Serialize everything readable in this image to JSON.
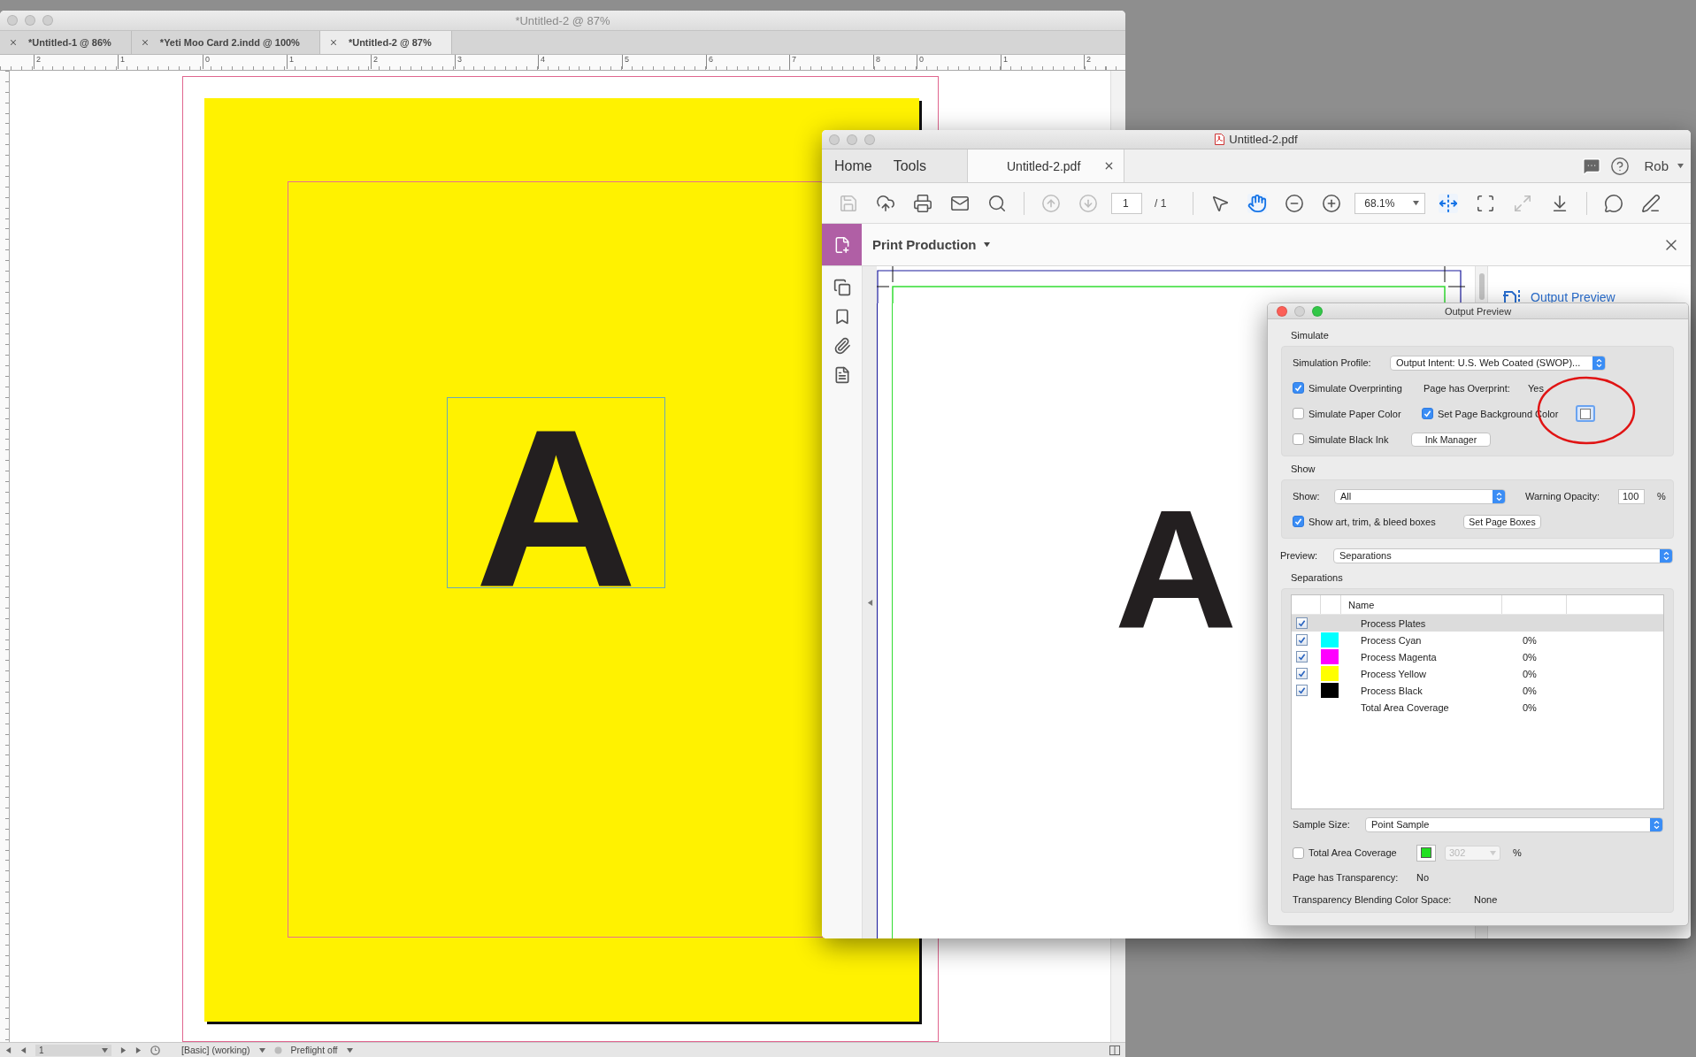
{
  "indesign": {
    "title": "*Untitled-2 @ 87%",
    "tabs": [
      {
        "label": "*Untitled-1 @ 86%",
        "selected": false
      },
      {
        "label": "*Yeti Moo Card 2.indd @ 100%",
        "selected": false
      },
      {
        "label": "*Untitled-2 @ 87%",
        "selected": true
      }
    ],
    "ruler_labels": [
      "2",
      "1",
      "0",
      "1",
      "2",
      "3",
      "4",
      "5",
      "6",
      "7",
      "8",
      "0",
      "1",
      "2"
    ],
    "frame_letter": "A",
    "status_bar": {
      "page": "1",
      "profile": "[Basic] (working)",
      "preflight": "Preflight off"
    }
  },
  "acrobat": {
    "title": "Untitled-2.pdf",
    "nav": [
      "Home",
      "Tools"
    ],
    "document_tab": "Untitled-2.pdf",
    "user": "Rob",
    "toolbar": [
      {
        "kind": "save",
        "disabled": true,
        "selected": false
      },
      {
        "kind": "upload",
        "disabled": false,
        "selected": false
      },
      {
        "kind": "print",
        "disabled": false,
        "selected": false
      },
      {
        "kind": "mail",
        "disabled": false,
        "selected": false
      },
      {
        "kind": "search",
        "disabled": false,
        "selected": false
      },
      {
        "kind": "separator"
      },
      {
        "kind": "prev-page",
        "disabled": true,
        "selected": false
      },
      {
        "kind": "next-page",
        "disabled": true,
        "selected": false
      },
      {
        "kind": "page-field",
        "value": "1",
        "total": "/ 1"
      },
      {
        "kind": "separator"
      },
      {
        "kind": "select",
        "disabled": false,
        "selected": false
      },
      {
        "kind": "hand",
        "disabled": false,
        "selected": true
      },
      {
        "kind": "zoom-out",
        "disabled": false,
        "selected": false
      },
      {
        "kind": "zoom-in",
        "disabled": false,
        "selected": false
      },
      {
        "kind": "zoom-field",
        "value": "68.1%"
      },
      {
        "kind": "fit-width",
        "disabled": false,
        "selected": true
      },
      {
        "kind": "fit-page",
        "disabled": false,
        "selected": false
      },
      {
        "kind": "full-screen",
        "disabled": true,
        "selected": false
      },
      {
        "kind": "scroll-mode",
        "disabled": false,
        "selected": false
      },
      {
        "kind": "separator"
      },
      {
        "kind": "comment",
        "disabled": false,
        "selected": false
      },
      {
        "kind": "sign",
        "disabled": false,
        "selected": false
      }
    ],
    "tool_panel": "Print Production",
    "page_letter": "A",
    "right_panel_link": "Output Preview"
  },
  "output_preview": {
    "title": "Output Preview",
    "simulate": {
      "label": "Simulate",
      "profile_label": "Simulation Profile:",
      "profile": "Output Intent: U.S. Web Coated (SWOP)...",
      "simulate_overprinting": {
        "label": "Simulate Overprinting",
        "checked": true
      },
      "overprint_label": "Page has Overprint:",
      "overprint_value": "Yes",
      "simulate_paper_color": {
        "label": "Simulate Paper Color",
        "checked": false
      },
      "set_page_background_color": {
        "label": "Set Page Background Color",
        "checked": true
      },
      "simulate_black_ink": {
        "label": "Simulate Black Ink",
        "checked": false
      },
      "ink_manager_button": "Ink Manager"
    },
    "show": {
      "label": "Show",
      "show_label": "Show:",
      "show_value": "All",
      "opacity_label": "Warning Opacity:",
      "opacity_value": "100",
      "opacity_unit": "%",
      "show_boxes": {
        "label": "Show art, trim, & bleed boxes",
        "checked": true
      },
      "page_boxes_button": "Set Page Boxes"
    },
    "preview_label": "Preview:",
    "preview_value": "Separations",
    "separations": {
      "label": "Separations",
      "columns": [
        "Name"
      ],
      "rows": [
        {
          "kind": "plates",
          "name": "Process Plates",
          "checked": true,
          "selected": true
        },
        {
          "kind": "ink",
          "name": "Process Cyan",
          "checked": true,
          "selected": false,
          "color": "#00ffff",
          "coverage": "0%"
        },
        {
          "kind": "ink",
          "name": "Process Magenta",
          "checked": true,
          "selected": false,
          "color": "#ff00ff",
          "coverage": "0%"
        },
        {
          "kind": "ink",
          "name": "Process Yellow",
          "checked": true,
          "selected": false,
          "color": "#ffff00",
          "coverage": "0%"
        },
        {
          "kind": "ink",
          "name": "Process Black",
          "checked": true,
          "selected": false,
          "color": "#000000",
          "coverage": "0%"
        },
        {
          "kind": "total",
          "name": "Total Area Coverage",
          "selected": false,
          "coverage": "0%"
        }
      ]
    },
    "sample_size_label": "Sample Size:",
    "sample_size": "Point Sample",
    "total_area_coverage": {
      "label": "Total Area Coverage",
      "checked": false,
      "value": "302",
      "value_disabled": true,
      "unit": "%"
    },
    "transparency_label": "Page has Transparency:",
    "transparency_value": "No",
    "blending_label": "Transparency Blending Color Space:",
    "blending_value": "None"
  }
}
